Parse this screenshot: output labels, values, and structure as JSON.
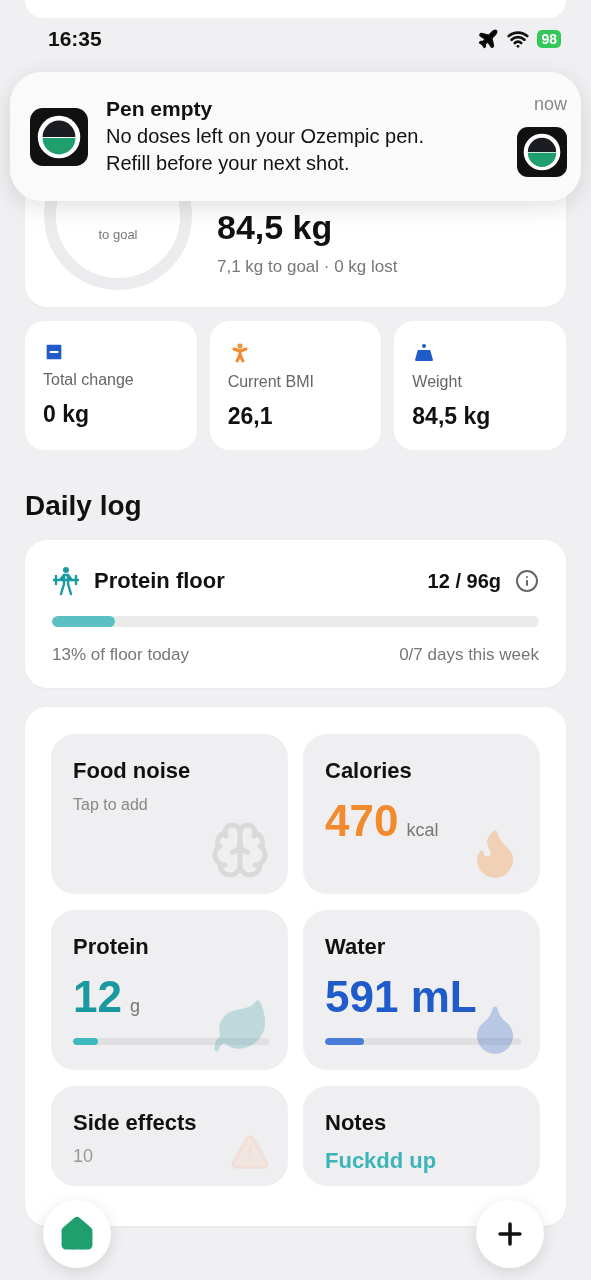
{
  "status_bar": {
    "time": "16:35",
    "battery": "98"
  },
  "notification": {
    "title": "Pen empty",
    "message": "No doses left on your Ozempic pen. Refill before your next shot.",
    "time": "now"
  },
  "results": {
    "ring_label": "to goal",
    "level": 0,
    "weight": "84,5 kg",
    "subtitle": "7,1 kg to goal · 0 kg lost"
  },
  "stats": [
    {
      "kind": "change",
      "label": "Total change",
      "value": "0 kg"
    },
    {
      "kind": "bmi",
      "label": "Current BMI",
      "value": "26,1"
    },
    {
      "kind": "weight",
      "label": "Weight",
      "value": "84,5 kg"
    }
  ],
  "daily_log": {
    "title": "Daily log"
  },
  "protein_floor": {
    "title": "Protein floor",
    "value": "12 / 96g",
    "level": 0.13,
    "today": "13% of floor today",
    "week": "0/7 days this week"
  },
  "tiles": [
    {
      "kind": "food",
      "title": "Food noise",
      "hint": "Tap to add"
    },
    {
      "kind": "calories",
      "title": "Calories",
      "value": "470",
      "unit": "kcal"
    },
    {
      "kind": "protein",
      "title": "Protein",
      "value": "12",
      "unit": "g",
      "level": 0.13
    },
    {
      "kind": "water",
      "title": "Water",
      "value": "591 mL",
      "level": 0.2
    },
    {
      "kind": "side",
      "title": "Side effects",
      "value": "10"
    },
    {
      "kind": "notes",
      "title": "Notes",
      "value": "Fuckdd up"
    }
  ]
}
